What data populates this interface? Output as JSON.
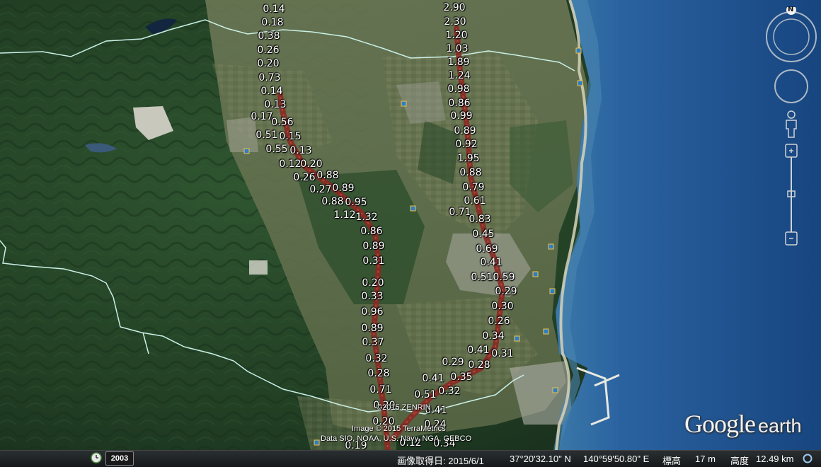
{
  "map": {
    "credits": {
      "zenrin": "©2015 ZENRIN",
      "terrametrics": "Image © 2015 TerraMetrics",
      "data": "Data SIO, NOAA, U.S. Navy, NGA, GEBCO"
    },
    "logo": {
      "google": "Google",
      "earth": "earth"
    }
  },
  "status": {
    "year": "2003",
    "imagery_date": "画像取得日: 2015/6/1",
    "lat": "37°20'32.10\" N",
    "lon": "140°59'50.80\" E",
    "elev_label": "標高",
    "elev_value": "17 m",
    "alt_label": "高度",
    "alt_value": "12.49 km"
  },
  "nav": {
    "compass_north": "N"
  },
  "dose_labels": [
    {
      "v": "0.14"
    },
    {
      "v": "0.18"
    },
    {
      "v": "0.38"
    },
    {
      "v": "0.26"
    },
    {
      "v": "0.20"
    },
    {
      "v": "0.73"
    },
    {
      "v": "0.14"
    },
    {
      "v": "0.13"
    },
    {
      "v": "0.17"
    },
    {
      "v": "0.56"
    },
    {
      "v": "0.51"
    },
    {
      "v": "0.15"
    },
    {
      "v": "0.55"
    },
    {
      "v": "0.13"
    },
    {
      "v": "0.12"
    },
    {
      "v": "0.20"
    },
    {
      "v": "0.26"
    },
    {
      "v": "0.88"
    },
    {
      "v": "0.27"
    },
    {
      "v": "0.89"
    },
    {
      "v": "0.88"
    },
    {
      "v": "0.95"
    },
    {
      "v": "1.12"
    },
    {
      "v": "1.32"
    },
    {
      "v": "0.86"
    },
    {
      "v": "0.89"
    },
    {
      "v": "0.31"
    },
    {
      "v": "0.20"
    },
    {
      "v": "0.33"
    },
    {
      "v": "0.96"
    },
    {
      "v": "0.89"
    },
    {
      "v": "0.37"
    },
    {
      "v": "0.32"
    },
    {
      "v": "0.28"
    },
    {
      "v": "0.71"
    },
    {
      "v": "0.20"
    },
    {
      "v": "0.20"
    },
    {
      "v": "0.19"
    },
    {
      "v": "0.21"
    },
    {
      "v": "2.90"
    },
    {
      "v": "2.30"
    },
    {
      "v": "1.20"
    },
    {
      "v": "1.03"
    },
    {
      "v": "1.89"
    },
    {
      "v": "1.24"
    },
    {
      "v": "0.98"
    },
    {
      "v": "0.86"
    },
    {
      "v": "0.99"
    },
    {
      "v": "0.89"
    },
    {
      "v": "0.92"
    },
    {
      "v": "1.95"
    },
    {
      "v": "0.88"
    },
    {
      "v": "0.79"
    },
    {
      "v": "0.61"
    },
    {
      "v": "0.71"
    },
    {
      "v": "0.83"
    },
    {
      "v": "0.45"
    },
    {
      "v": "0.69"
    },
    {
      "v": "0.41"
    },
    {
      "v": "0.51"
    },
    {
      "v": "0.59"
    },
    {
      "v": "0.29"
    },
    {
      "v": "0.30"
    },
    {
      "v": "0.26"
    },
    {
      "v": "0.34"
    },
    {
      "v": "0.41"
    },
    {
      "v": "0.31"
    },
    {
      "v": "0.28"
    },
    {
      "v": "0.29"
    },
    {
      "v": "0.41"
    },
    {
      "v": "0.35"
    },
    {
      "v": "0.32"
    },
    {
      "v": "0.51"
    },
    {
      "v": "0.41"
    },
    {
      "v": "0.24"
    },
    {
      "v": "0.12"
    },
    {
      "v": "0.34"
    },
    {
      "v": "0.20"
    }
  ],
  "colors": {
    "forest": "#1f3b22",
    "ocean": "#1d4e86",
    "route": "#8a2a24",
    "boundary": "#c9f0e6"
  }
}
